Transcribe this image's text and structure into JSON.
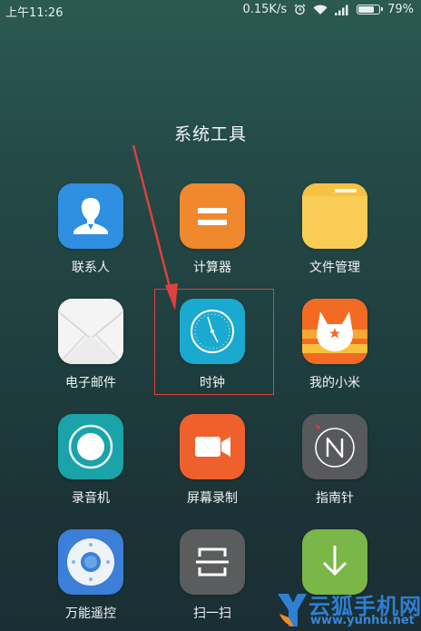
{
  "status_bar": {
    "time": "上午11:26",
    "network_speed": "0.15K/s",
    "battery_percent": "79%",
    "battery_level": 0.79,
    "icons": [
      "alarm-icon",
      "wifi-icon",
      "signal-icon",
      "battery-icon"
    ]
  },
  "folder": {
    "title": "系统工具"
  },
  "apps": [
    {
      "label": "联系人",
      "icon": "contacts-icon",
      "color": "#2f8fe0"
    },
    {
      "label": "计算器",
      "icon": "calculator-icon",
      "color": "#f0882d"
    },
    {
      "label": "文件管理",
      "icon": "folder-icon",
      "color": "#f7c141"
    },
    {
      "label": "电子邮件",
      "icon": "mail-icon",
      "color": "#f1f1f1"
    },
    {
      "label": "时钟",
      "icon": "clock-icon",
      "color": "#1aa9cf"
    },
    {
      "label": "我的小米",
      "icon": "mi-bunny-icon",
      "color": "#f58b25"
    },
    {
      "label": "录音机",
      "icon": "recorder-icon",
      "color": "#1aa3a8"
    },
    {
      "label": "屏幕录制",
      "icon": "screen-record-icon",
      "color": "#f0602d"
    },
    {
      "label": "指南针",
      "icon": "compass-icon",
      "color": "#58595c"
    },
    {
      "label": "万能遥控",
      "icon": "remote-icon",
      "color": "#3b7fd8"
    },
    {
      "label": "扫一扫",
      "icon": "scan-icon",
      "color": "#5b5c5e"
    },
    {
      "label": "",
      "icon": "download-icon",
      "color": "#7ab648"
    }
  ],
  "watermark": {
    "title": "云狐手机网",
    "url": "www.yunhu.net"
  },
  "accent": {
    "highlight": "#e0403f"
  }
}
